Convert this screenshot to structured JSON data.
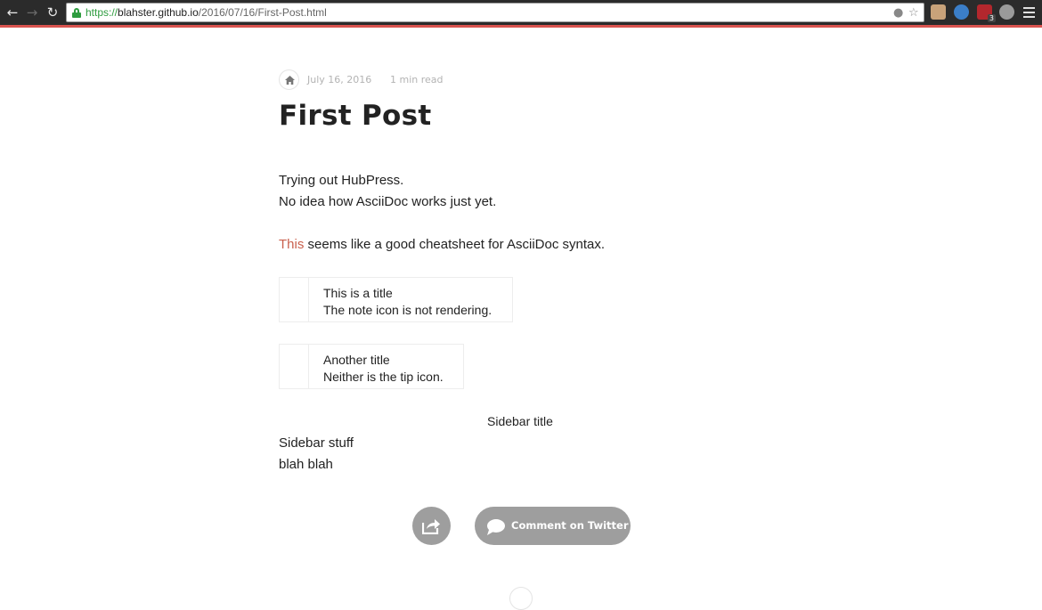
{
  "browser": {
    "url_scheme": "https://",
    "url_host": "blahster.github.io",
    "url_path": "/2016/07/16/First-Post.html",
    "extension_badge": "3"
  },
  "post": {
    "date": "July 16, 2016",
    "read_time": "1 min read",
    "title": "First Post",
    "para1": "Trying out HubPress.",
    "para2": "No idea how AsciiDoc works just yet.",
    "link_text": "This",
    "link_rest": " seems like a good cheatsheet for AsciiDoc syntax.",
    "note": {
      "title": "This is a title",
      "body": "The note icon is not rendering."
    },
    "tip": {
      "title": "Another title",
      "body": "Neither is the tip icon."
    },
    "sidebar": {
      "title": "Sidebar title",
      "line1": "Sidebar stuff",
      "line2": "blah blah"
    },
    "comment_label": "Comment on Twitter"
  },
  "colors": {
    "accent_bar": "#d9534f",
    "link": "#c9604d",
    "button_gray": "#9e9e9e"
  }
}
